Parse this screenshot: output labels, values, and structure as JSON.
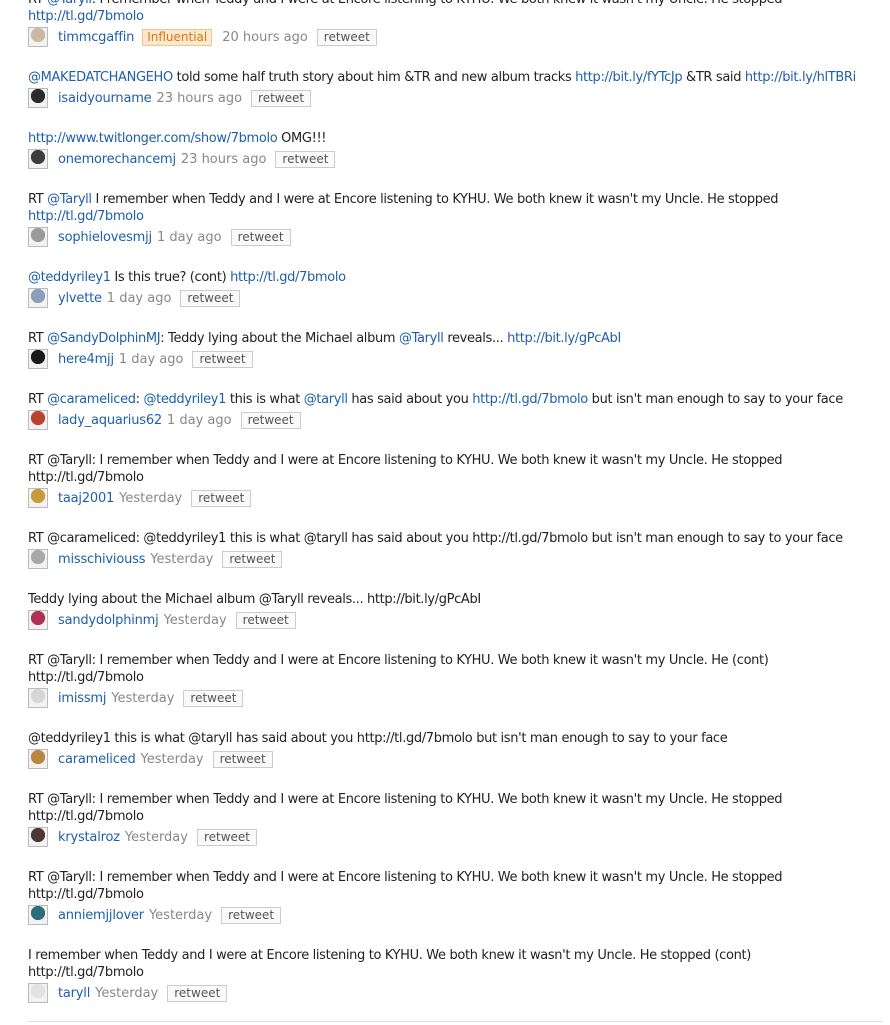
{
  "stream": {
    "tweets": [
      {
        "text": [
          {
            "t": "RT "
          },
          {
            "t": "@Taryll",
            "link": true
          },
          {
            "t": ": I remember when Teddy and I were at Encore listening to KYHU. We both knew it wasn't my Uncle. He stopped"
          },
          {
            "br": true
          },
          {
            "t": "http://tl.gd/7bmolo",
            "link": true
          }
        ],
        "user": "timmcgaffin",
        "badge": "Influential",
        "time": "20 hours ago",
        "retweet": "retweet",
        "avatar": "#c9b8a3"
      },
      {
        "text": [
          {
            "t": "@MAKEDATCHANGEHO",
            "link": true
          },
          {
            "t": " told some half truth story about him &TR and new album tracks "
          },
          {
            "t": "http://bit.ly/fYTcJp",
            "link": true
          },
          {
            "t": " &TR said "
          },
          {
            "t": "http://bit.ly/hlTBRi",
            "link": true
          }
        ],
        "user": "isaidyourname",
        "time": "23 hours ago",
        "retweet": "retweet",
        "avatar": "#2b2b2b"
      },
      {
        "text": [
          {
            "t": "http://www.twitlonger.com/show/7bmolo",
            "link": true
          },
          {
            "t": " OMG!!!"
          }
        ],
        "user": "onemorechancemj",
        "time": "23 hours ago",
        "retweet": "retweet",
        "avatar": "#3d3d3d"
      },
      {
        "text": [
          {
            "t": "RT "
          },
          {
            "t": "@Taryll",
            "link": true
          },
          {
            "t": " I remember when Teddy and I were at Encore listening to KYHU. We both knew it wasn't my Uncle. He stopped"
          },
          {
            "br": true
          },
          {
            "t": "http://tl.gd/7bmolo",
            "link": true
          }
        ],
        "user": "sophielovesmjj",
        "time": "1 day ago",
        "retweet": "retweet",
        "avatar": "#9a9a9a"
      },
      {
        "text": [
          {
            "t": "@teddyriley1",
            "link": true
          },
          {
            "t": " Is this true? (cont) "
          },
          {
            "t": "http://tl.gd/7bmolo",
            "link": true
          }
        ],
        "user": "ylvette",
        "time": "1 day ago",
        "retweet": "retweet",
        "avatar": "#8aa0b8"
      },
      {
        "text": [
          {
            "t": "RT "
          },
          {
            "t": "@SandyDolphinMJ",
            "link": true
          },
          {
            "t": ": Teddy lying about the Michael album "
          },
          {
            "t": "@Taryll",
            "link": true
          },
          {
            "t": " reveals... "
          },
          {
            "t": "http://bit.ly/gPcAbI",
            "link": true
          }
        ],
        "user": "here4mjj",
        "time": "1 day ago",
        "retweet": "retweet",
        "avatar": "#1a1a1a"
      },
      {
        "text": [
          {
            "t": "RT "
          },
          {
            "t": "@carameliced",
            "link": true
          },
          {
            "t": ": "
          },
          {
            "t": "@teddyriley1",
            "link": true
          },
          {
            "t": " this is what "
          },
          {
            "t": "@taryll",
            "link": true
          },
          {
            "t": " has said about you "
          },
          {
            "t": "http://tl.gd/7bmolo",
            "link": true
          },
          {
            "t": " but isn't man enough to say to your face"
          }
        ],
        "user": "lady_aquarius62",
        "time": "1 day ago",
        "retweet": "retweet",
        "avatar": "#b8442f"
      },
      {
        "text": [
          {
            "t": "RT @Taryll: I remember when Teddy and I were at Encore listening to KYHU. We both knew it wasn't my Uncle. He stopped"
          },
          {
            "br": true
          },
          {
            "t": "http://tl.gd/7bmolo"
          }
        ],
        "user": "taaj2001",
        "time": "Yesterday",
        "retweet": "retweet",
        "avatar": "#c79a3a"
      },
      {
        "text": [
          {
            "t": "RT @carameliced: @teddyriley1 this is what @taryll has said about you http://tl.gd/7bmolo but isn't man enough to say to your face"
          }
        ],
        "user": "misschiviouss",
        "time": "Yesterday",
        "retweet": "retweet",
        "avatar": "#a8a8a8"
      },
      {
        "text": [
          {
            "t": "Teddy lying about the Michael album @Taryll reveals... http://bit.ly/gPcAbI"
          }
        ],
        "user": "sandydolphinmj",
        "time": "Yesterday",
        "retweet": "retweet",
        "avatar": "#b0305a"
      },
      {
        "text": [
          {
            "t": "RT @Taryll: I remember when Teddy and I were at Encore listening to KYHU. We both knew it wasn't my Uncle. He (cont)"
          },
          {
            "br": true
          },
          {
            "t": "http://tl.gd/7bmolo"
          }
        ],
        "user": "imissmj",
        "time": "Yesterday",
        "retweet": "retweet",
        "avatar": "#d6d6d6"
      },
      {
        "text": [
          {
            "t": "@teddyriley1 this is what @taryll has said about you http://tl.gd/7bmolo but isn't man enough to say to your face"
          }
        ],
        "user": "carameliced",
        "time": "Yesterday",
        "retweet": "retweet",
        "avatar": "#b8863f"
      },
      {
        "text": [
          {
            "t": "RT @Taryll: I remember when Teddy and I were at Encore listening to KYHU. We both knew it wasn't my Uncle. He stopped"
          },
          {
            "br": true
          },
          {
            "t": "http://tl.gd/7bmolo"
          }
        ],
        "user": "krystalroz",
        "time": "Yesterday",
        "retweet": "retweet",
        "avatar": "#4a3a33"
      },
      {
        "text": [
          {
            "t": "RT @Taryll: I remember when Teddy and I were at Encore listening to KYHU. We both knew it wasn't my Uncle. He stopped"
          },
          {
            "br": true
          },
          {
            "t": "http://tl.gd/7bmolo"
          }
        ],
        "user": "anniemjjlover",
        "time": "Yesterday",
        "retweet": "retweet",
        "avatar": "#2a6f7a"
      },
      {
        "text": [
          {
            "t": "I remember when Teddy and I were at Encore listening to KYHU. We both knew it wasn't my Uncle. He stopped (cont)"
          },
          {
            "br": true
          },
          {
            "t": "http://tl.gd/7bmolo"
          }
        ],
        "user": "taryll",
        "time": "Yesterday",
        "retweet": "retweet",
        "avatar": "#e2e2e2"
      }
    ]
  }
}
